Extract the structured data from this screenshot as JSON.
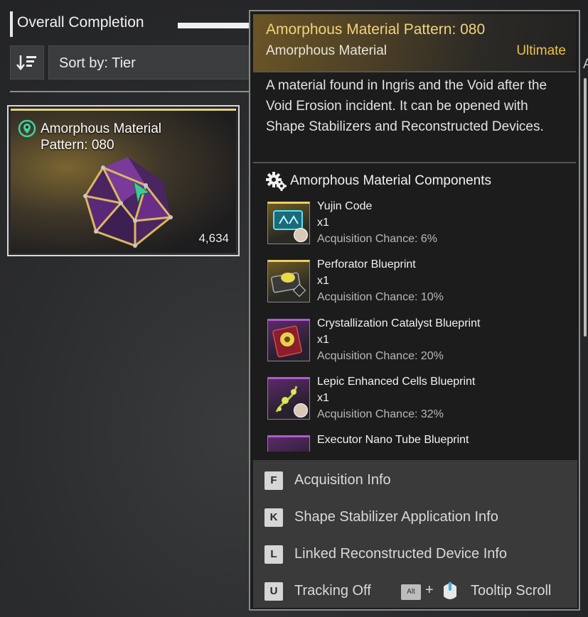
{
  "header": {
    "title": "Overall Completion",
    "progress_fraction": 0.8
  },
  "sort": {
    "label": "Sort by: Tier"
  },
  "card": {
    "name_line1": "Amorphous Material",
    "name_line2": "Pattern: 080",
    "count": "4,634"
  },
  "tooltip": {
    "title": "Amorphous Material Pattern: 080",
    "type": "Amorphous Material",
    "rarity": "Ultimate",
    "description": "A material found in Ingris and the Void after the Void Erosion incident. It can be opened with Shape Stabilizers and Reconstructed Devices.",
    "components_heading": "Amorphous Material Components",
    "components": [
      {
        "name": "Yujin Code",
        "qty": "x1",
        "chance": "Acquisition Chance: 6%"
      },
      {
        "name": "Perforator Blueprint",
        "qty": "x1",
        "chance": "Acquisition Chance: 10%"
      },
      {
        "name": "Crystallization Catalyst Blueprint",
        "qty": "x1",
        "chance": "Acquisition Chance: 20%"
      },
      {
        "name": "Lepic Enhanced Cells Blueprint",
        "qty": "x1",
        "chance": "Acquisition Chance: 32%"
      },
      {
        "name": "Executor Nano Tube Blueprint"
      }
    ],
    "actions": [
      {
        "key": "F",
        "label": "Acquisition Info"
      },
      {
        "key": "K",
        "label": "Shape Stabilizer Application Info"
      },
      {
        "key": "L",
        "label": "Linked Reconstructed Device Info"
      },
      {
        "key": "U",
        "label": "Tracking Off"
      }
    ],
    "scroll_hint": {
      "alt_key": "Alt",
      "plus": "+",
      "label": "Tooltip Scroll"
    }
  },
  "right_edge_text": "A",
  "colors": {
    "title_gold": "#f2d37a",
    "rarity": "#eec247",
    "accent_gold": "#e6d27a",
    "purple": "#b05ad0"
  }
}
